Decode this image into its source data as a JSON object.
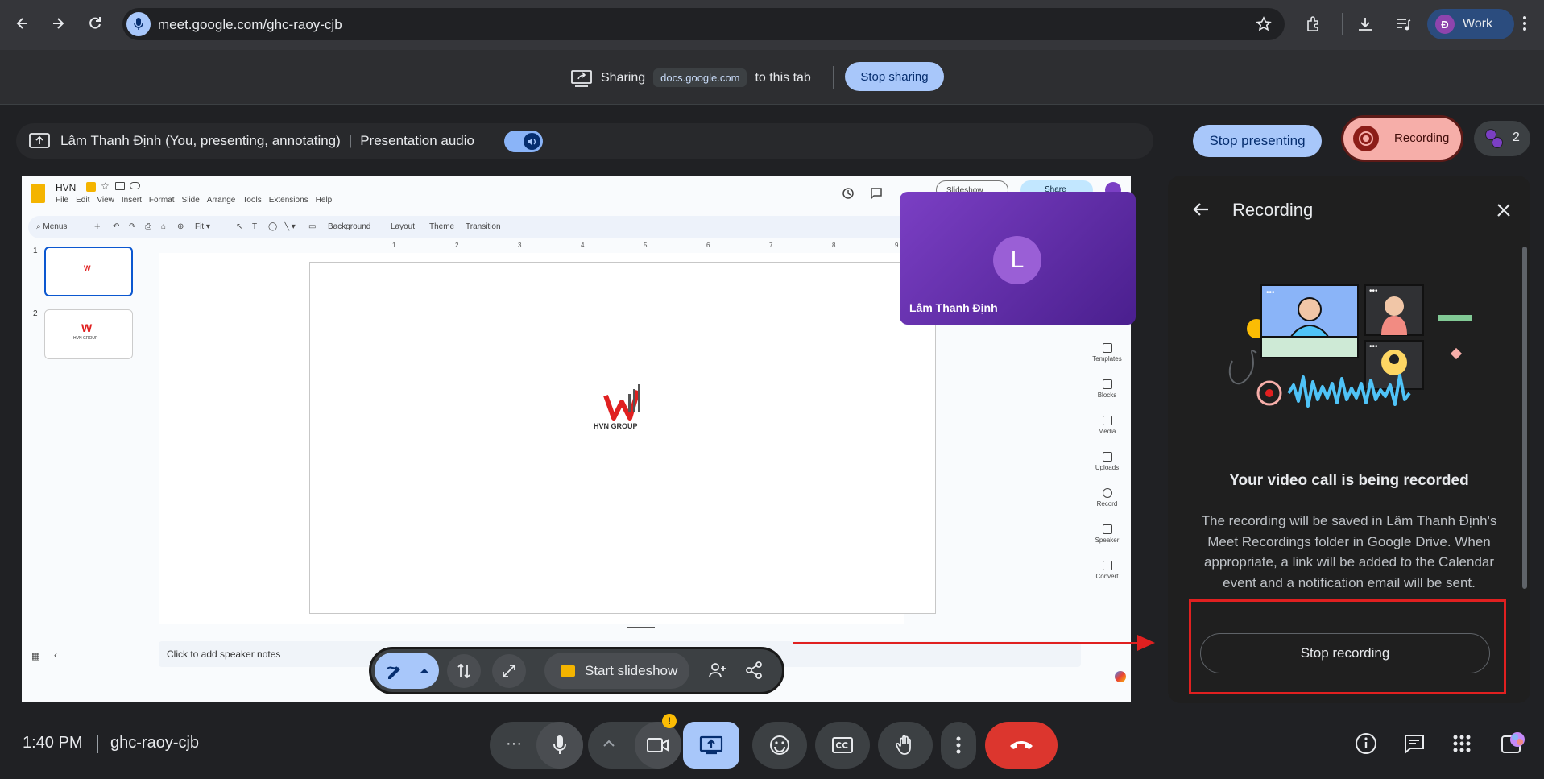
{
  "browser": {
    "url": "meet.google.com/ghc-raoy-cjb",
    "profile_initial": "Đ",
    "profile_label": "Work"
  },
  "share_bar": {
    "sharing_label": "Sharing",
    "domain": "docs.google.com",
    "to_this_tab": "to this tab",
    "stop_sharing": "Stop sharing"
  },
  "presenting_bar": {
    "presenter_label": "Lâm Thanh Định (You, presenting, annotating)",
    "audio_label": "Presentation audio",
    "stop_presenting": "Stop presenting",
    "recording_label": "Recording",
    "participants_count": "2"
  },
  "slides": {
    "title": "HVN",
    "menus": [
      "File",
      "Edit",
      "View",
      "Insert",
      "Format",
      "Slide",
      "Arrange",
      "Tools",
      "Extensions",
      "Help"
    ],
    "toolbar_search": "Menus",
    "toolbar_zoom": "Fit",
    "toolbar_background": "Background",
    "toolbar_layout": "Layout",
    "toolbar_theme": "Theme",
    "toolbar_transition": "Transition",
    "slideshow_label": "Slideshow",
    "share_label": "Share",
    "ruler_numbers": [
      "1",
      "2",
      "3",
      "4",
      "5",
      "6",
      "7",
      "8",
      "9"
    ],
    "slide_numbers": [
      "1",
      "2"
    ],
    "logo_text": "HVN GROUP",
    "thumb_logo_text": "HVN GROUP",
    "speaker_notes": "Click to add speaker notes",
    "rail": [
      "Templates",
      "Blocks",
      "Media",
      "Uploads",
      "Record",
      "Speaker",
      "Convert"
    ]
  },
  "tile": {
    "avatar_initial": "L",
    "name": "Lâm Thanh Định"
  },
  "slide_controls": {
    "start_slideshow": "Start slideshow"
  },
  "panel": {
    "title": "Recording",
    "heading": "Your video call is being recorded",
    "body": "The recording will be saved in Lâm Thanh Định's Meet Recordings folder in Google Drive. When appropriate, a link will be added to the Calendar event and a notification email will be sent.",
    "stop_recording": "Stop recording"
  },
  "bottom_bar": {
    "time": "1:40 PM",
    "meeting_code": "ghc-raoy-cjb",
    "more_dots": "···"
  },
  "colors": {
    "accent_blue": "#a8c7fa",
    "recording_pink": "#f6aea9",
    "end_call_red": "#dc362e",
    "annotation_red": "#e02020"
  }
}
